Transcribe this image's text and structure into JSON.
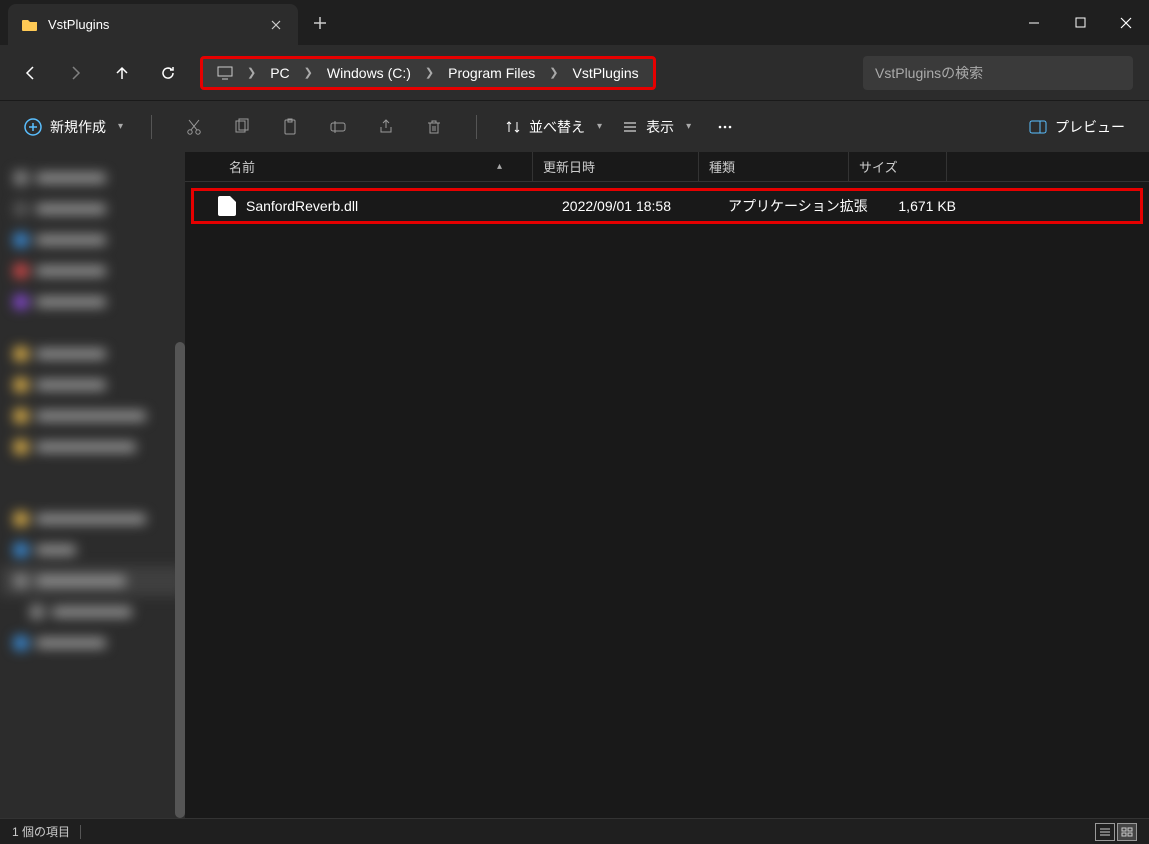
{
  "tab": {
    "title": "VstPlugins"
  },
  "breadcrumb": {
    "items": [
      "PC",
      "Windows (C:)",
      "Program Files",
      "VstPlugins"
    ]
  },
  "search": {
    "placeholder": "VstPluginsの検索"
  },
  "toolbar": {
    "new_label": "新規作成",
    "sort_label": "並べ替え",
    "view_label": "表示",
    "preview_label": "プレビュー"
  },
  "columns": {
    "name": "名前",
    "date": "更新日時",
    "type": "種類",
    "size": "サイズ"
  },
  "files": [
    {
      "name": "SanfordReverb.dll",
      "date": "2022/09/01 18:58",
      "type": "アプリケーション拡張",
      "size": "1,671 KB"
    }
  ],
  "status": {
    "count": "1 個の項目"
  }
}
